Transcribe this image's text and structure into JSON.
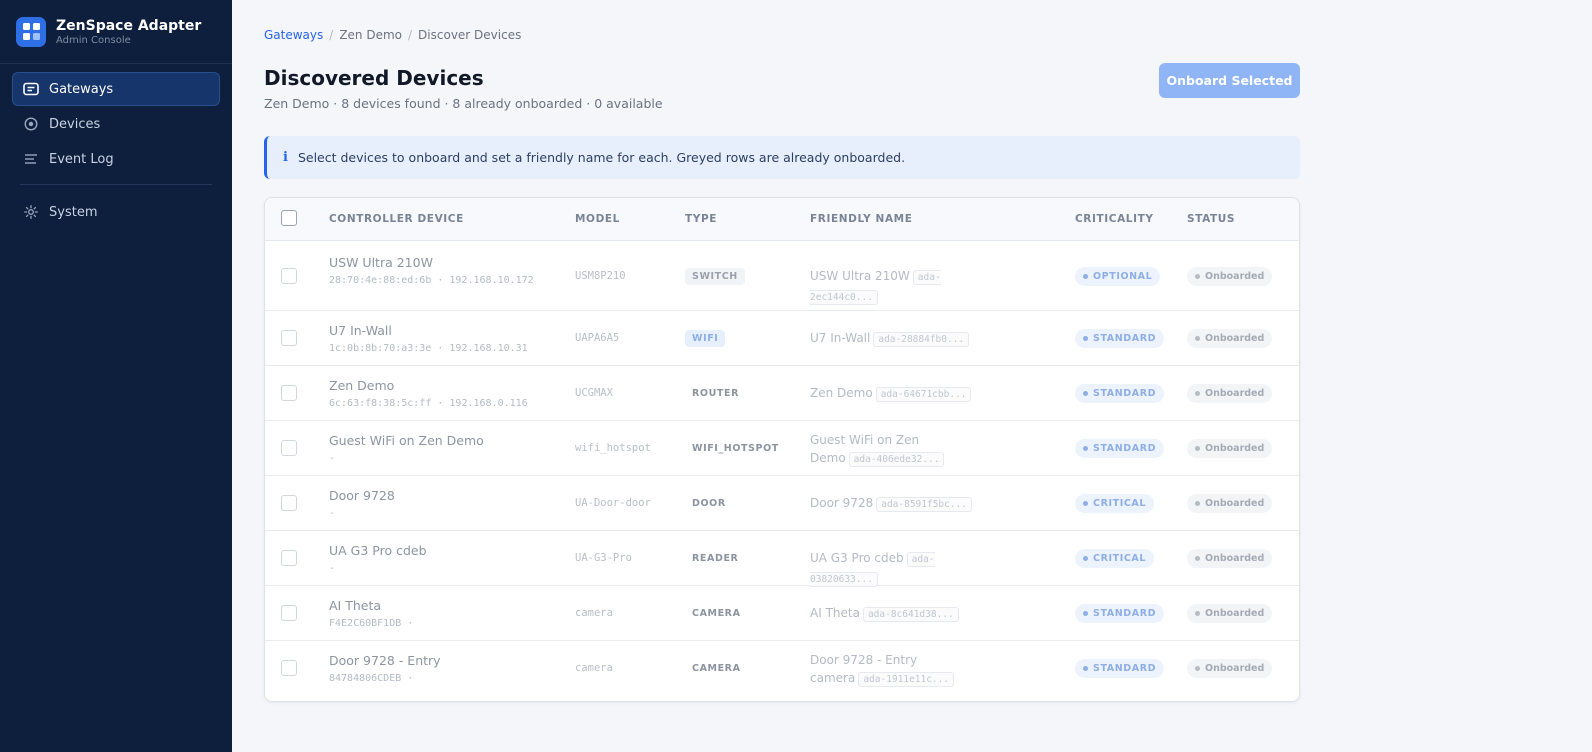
{
  "app": {
    "title": "ZenSpace Adapter",
    "subtitle": "Admin Console"
  },
  "sidebar": {
    "items": [
      {
        "label": "Gateways",
        "icon": "gateway-icon",
        "active": true
      },
      {
        "label": "Devices",
        "icon": "device-icon",
        "active": false
      },
      {
        "label": "Event Log",
        "icon": "list-icon",
        "active": false
      }
    ],
    "secondary": [
      {
        "label": "System",
        "icon": "gear-icon",
        "active": false
      }
    ]
  },
  "breadcrumb": {
    "root": "Gateways",
    "middle": "Zen Demo",
    "current": "Discover Devices"
  },
  "page": {
    "title": "Discovered Devices",
    "subtitle": "Zen Demo · 8 devices found · 8 already onboarded · 0 available",
    "onboard_label": "Onboard Selected"
  },
  "info": {
    "icon": "info-icon",
    "text": "Select devices to onboard and set a friendly name for each. Greyed rows are already onboarded."
  },
  "table": {
    "columns": {
      "device": "CONTROLLER DEVICE",
      "model": "MODEL",
      "type": "TYPE",
      "friendly": "FRIENDLY NAME",
      "criticality": "CRITICALITY",
      "status": "STATUS"
    },
    "rows": [
      {
        "name": "USW Ultra 210W",
        "sub": "28:70:4e:88:ed:6b · 192.168.10.172",
        "model": "USM8P210",
        "type": "SWITCH",
        "friendly": "USW Ultra 210W",
        "id": "ada-2ec144c0...",
        "criticality": "OPTIONAL",
        "status": "Onboarded"
      },
      {
        "name": "U7 In-Wall",
        "sub": "1c:0b:8b:70:a3:3e · 192.168.10.31",
        "model": "UAPA6A5",
        "type": "WIFI",
        "friendly": "U7 In-Wall",
        "id": "ada-28884fb0...",
        "criticality": "STANDARD",
        "status": "Onboarded"
      },
      {
        "name": "Zen Demo",
        "sub": "6c:63:f8:38:5c:ff · 192.168.0.116",
        "model": "UCGMAX",
        "type": "ROUTER",
        "friendly": "Zen Demo",
        "id": "ada-64671cbb...",
        "criticality": "STANDARD",
        "status": "Onboarded"
      },
      {
        "name": "Guest WiFi on Zen Demo",
        "sub": "-",
        "model": "wifi_hotspot",
        "type": "WIFI_HOTSPOT",
        "friendly": "Guest WiFi on Zen Demo",
        "id": "ada-406ede32...",
        "criticality": "STANDARD",
        "status": "Onboarded"
      },
      {
        "name": "Door 9728",
        "sub": "-",
        "model": "UA-Door-door",
        "type": "DOOR",
        "friendly": "Door 9728",
        "id": "ada-8591f5bc...",
        "criticality": "CRITICAL",
        "status": "Onboarded"
      },
      {
        "name": "UA G3 Pro cdeb",
        "sub": "-",
        "model": "UA-G3-Pro",
        "type": "READER",
        "friendly": "UA G3 Pro cdeb",
        "id": "ada-03820633...",
        "criticality": "CRITICAL",
        "status": "Onboarded"
      },
      {
        "name": "AI Theta",
        "sub": "F4E2C60BF1DB ·",
        "model": "camera",
        "type": "CAMERA",
        "friendly": "AI Theta",
        "id": "ada-8c641d38...",
        "criticality": "STANDARD",
        "status": "Onboarded"
      },
      {
        "name": "Door 9728 - Entry",
        "sub": "84784806CDEB ·",
        "model": "camera",
        "type": "CAMERA",
        "friendly": "Door 9728 - Entry camera",
        "id": "ada-1911e11c...",
        "criticality": "STANDARD",
        "status": "Onboarded"
      }
    ]
  }
}
